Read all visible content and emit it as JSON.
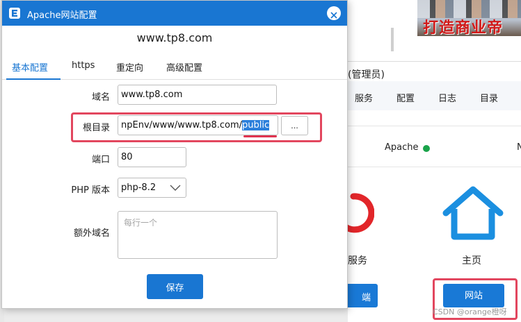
{
  "dialog": {
    "title": "Apache网站配置",
    "site_name": "www.tp8.com",
    "tabs": [
      {
        "label": "基本配置",
        "active": true
      },
      {
        "label": "https",
        "active": false
      },
      {
        "label": "重定向",
        "active": false
      },
      {
        "label": "高级配置",
        "active": false
      }
    ],
    "fields": {
      "domain_label": "域名",
      "domain_value": "www.tp8.com",
      "root_label": "根目录",
      "root_value_visible": "npEnv/www/www.tp8.com/",
      "root_value_selected": "public",
      "browse_label": "...",
      "port_label": "端口",
      "port_value": "80",
      "php_label": "PHP 版本",
      "php_value": "php-8.2",
      "extra_label": "额外域名",
      "extra_placeholder": "每行一个"
    },
    "save_label": "保存",
    "colors": {
      "accent": "#1976d2",
      "highlight": "#e2465e"
    }
  },
  "background_app": {
    "banner_text": "打造商业帝",
    "title_fragment": "(管理员)",
    "menu": [
      "服务",
      "配置",
      "日志",
      "目录"
    ],
    "status": {
      "service": "Apache",
      "state_color": "#1aa34a",
      "next_fragment": "N"
    },
    "service_label": "服务",
    "home_label": "主页",
    "left_button_fragment": "端",
    "site_button": "网站",
    "watermark": "CSDN @orange橙呀"
  }
}
